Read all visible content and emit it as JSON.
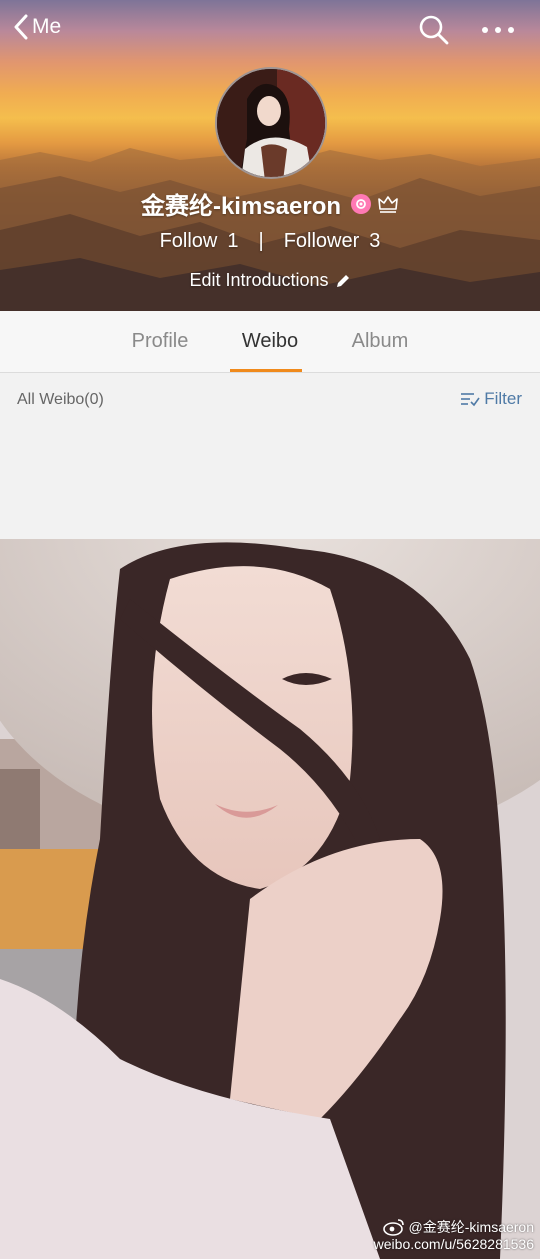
{
  "nav": {
    "back_label": "Me"
  },
  "profile": {
    "name": "金赛纶-kimsaeron",
    "follow_label": "Follow",
    "follow_count": "1",
    "separator": "|",
    "follower_label": "Follower",
    "follower_count": "3",
    "edit_label": "Edit Introductions"
  },
  "tabs": [
    {
      "label": "Profile",
      "active": false
    },
    {
      "label": "Weibo",
      "active": true
    },
    {
      "label": "Album",
      "active": false
    }
  ],
  "feed": {
    "all_label": "All Weibo(0)",
    "filter_label": "Filter"
  },
  "watermark": {
    "handle": "@金赛纶-kimsaeron",
    "url": "weibo.com/u/5628281536"
  },
  "icons": {
    "back": "chevron-left-icon",
    "search": "search-icon",
    "more": "more-dots-icon",
    "verified": "verified-badge-icon",
    "crown": "crown-icon",
    "edit": "pencil-icon",
    "filter": "filter-icon",
    "weibo": "weibo-logo-icon"
  },
  "colors": {
    "accent": "#f08a1c",
    "link": "#4f7aa6",
    "badge": "#ff79b4"
  }
}
